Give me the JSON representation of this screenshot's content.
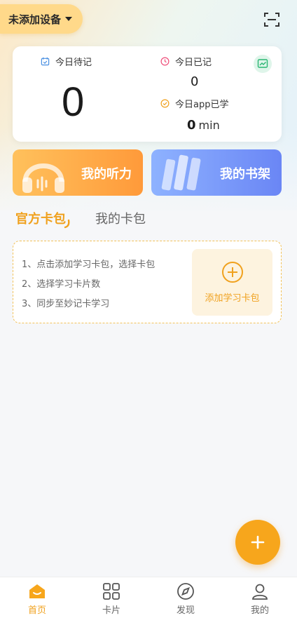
{
  "header": {
    "device_label": "未添加设备",
    "icons": {
      "device_dropdown": "caret-down-icon",
      "scan": "scan-icon"
    }
  },
  "stats": {
    "pending_label": "今日待记",
    "pending_value": "0",
    "done_label": "今日已记",
    "done_value": "0",
    "study_label": "今日app已学",
    "study_value": "0",
    "study_unit": "min",
    "icons": {
      "pending": "calendar-check-icon",
      "done": "clock-icon",
      "study": "check-circle-icon",
      "chart": "trend-chart-icon"
    }
  },
  "features": [
    {
      "title": "我的听力",
      "icon": "headphones-icon",
      "color": "#ff9a3a"
    },
    {
      "title": "我的书架",
      "icon": "books-icon",
      "color": "#6a86f5"
    }
  ],
  "tabs": [
    {
      "label": "官方卡包",
      "active": true
    },
    {
      "label": "我的卡包",
      "active": false
    }
  ],
  "pack_empty": {
    "steps": [
      "1、点击添加学习卡包，选择卡包",
      "2、选择学习卡片数",
      "3、同步至妙记卡学习"
    ],
    "add_label": "添加学习卡包",
    "add_icon": "plus-circle-icon"
  },
  "fab": {
    "icon": "plus-icon"
  },
  "bottom_nav": [
    {
      "label": "首页",
      "icon": "home-icon",
      "active": true
    },
    {
      "label": "卡片",
      "icon": "grid-icon",
      "active": false
    },
    {
      "label": "发现",
      "icon": "compass-icon",
      "active": false
    },
    {
      "label": "我的",
      "icon": "user-icon",
      "active": false
    }
  ],
  "colors": {
    "accent": "#f0a11e",
    "fab": "#f7a61c",
    "listen_card": "#ff9a3a",
    "shelf_card": "#6a86f5"
  }
}
